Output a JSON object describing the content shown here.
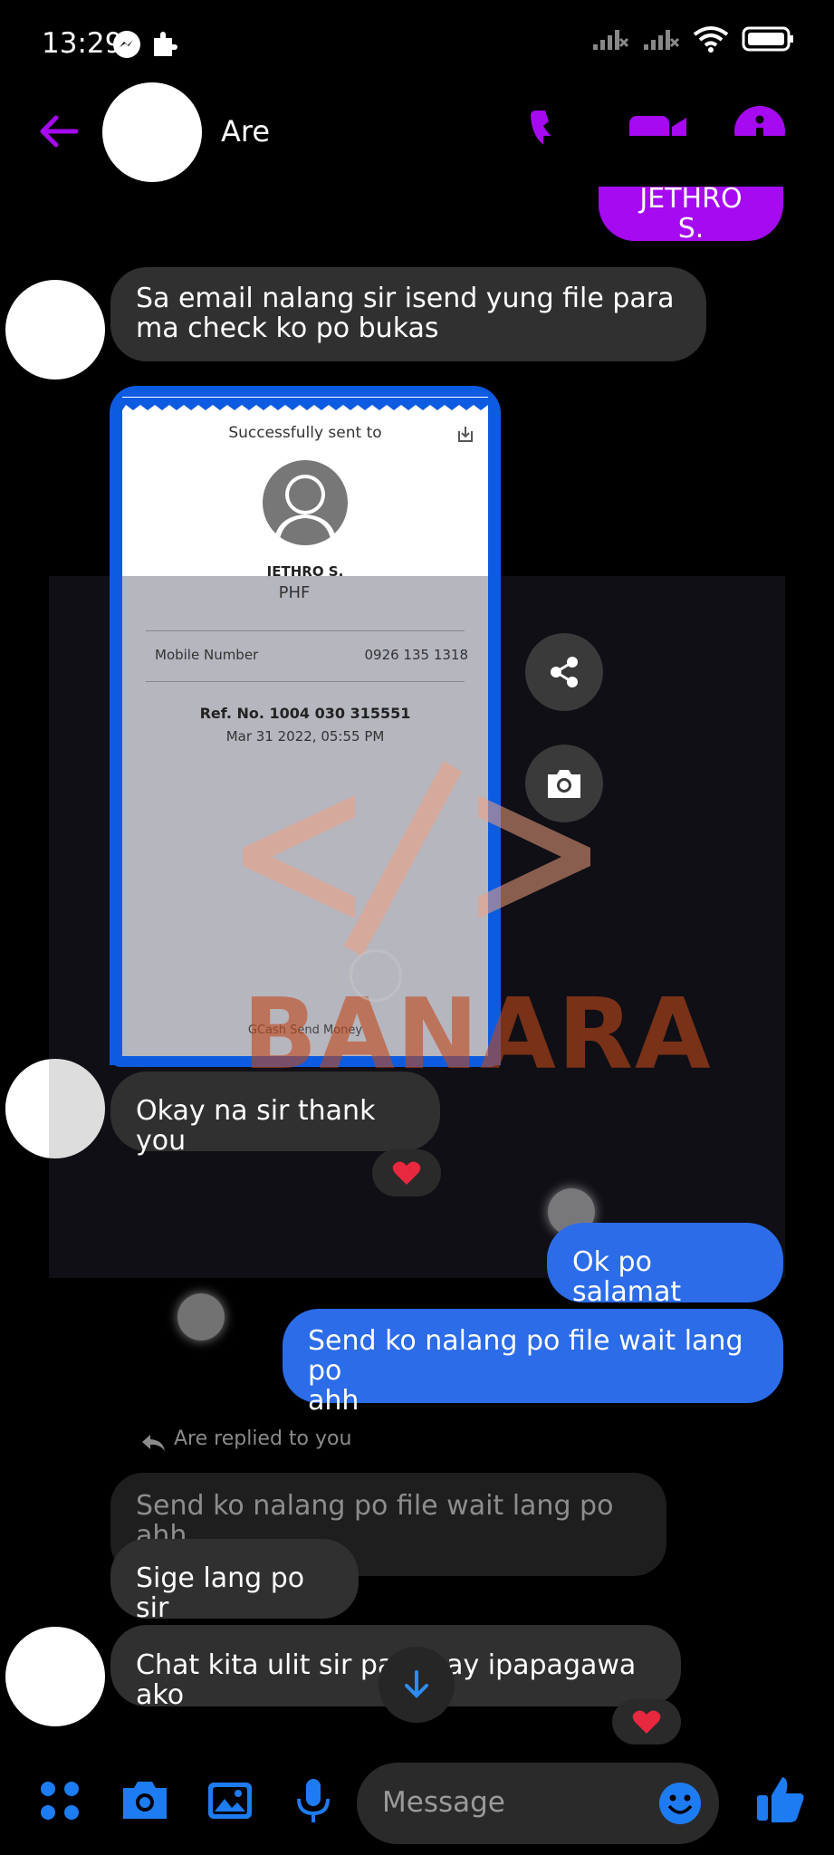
{
  "status": {
    "time": "13:29"
  },
  "header": {
    "contact_name": "Are"
  },
  "messages": {
    "sent_clipped": "JETHRO S.",
    "m1_line1": "Sa email nalang sir isend yung file para",
    "m1_line2": "ma check ko po bukas",
    "m2": "Okay na sir thank you",
    "m3": "Ok po salamat",
    "m4_line1": "Send ko nalang po file wait lang po",
    "m4_line2": "ahh",
    "reply_meta": "Are replied to you",
    "reply_quote": "Send ko nalang po file wait lang po ahh",
    "m5": "Sige lang po sir",
    "m6": "Chat kita ulit sir pag may ipapagawa ako"
  },
  "receipt": {
    "title": "Successfully sent to",
    "name": "JETHRO S.",
    "currency": "PHF",
    "mobile_label": "Mobile Number",
    "mobile_value": "0926 135 1318",
    "ref": "Ref. No. 1004 030 315551",
    "date": "Mar 31 2022, 05:55 PM",
    "footer": "GCash Send Money"
  },
  "watermark": {
    "text": "BANARA"
  },
  "composer": {
    "placeholder": "Message"
  },
  "colors": {
    "accent_purple": "#a50af0",
    "sent_blue": "#2c6ce8",
    "messenger_blue": "#1e7cf2",
    "received": "#303030"
  }
}
